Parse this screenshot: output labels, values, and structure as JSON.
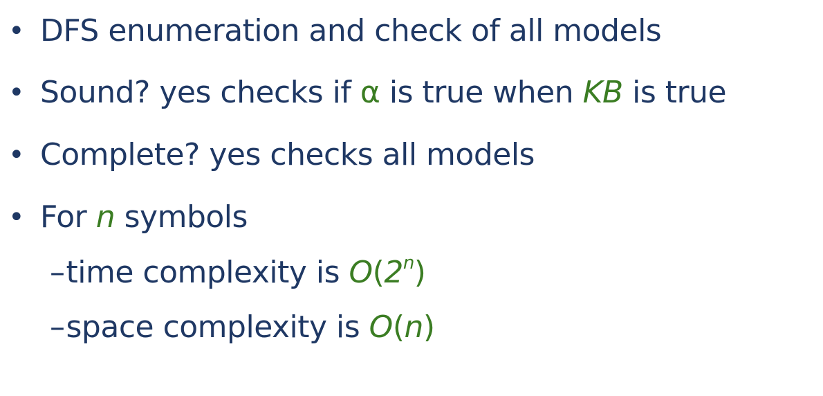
{
  "bullets": [
    {
      "text": "DFS enumeration and check of all models"
    },
    {
      "prefix": "Sound? yes checks if ",
      "alpha": "α",
      "middle": " is true when ",
      "kb": "KB",
      "suffix": " is true"
    },
    {
      "text": "Complete? yes checks all models"
    },
    {
      "prefix": "For ",
      "n": "n",
      "suffix": " symbols"
    }
  ],
  "sub_bullets": [
    {
      "dash": "–",
      "prefix": "time complexity is ",
      "big_o": "O",
      "open": "(",
      "base": "2",
      "exponent": "n",
      "close": ")"
    },
    {
      "dash": "–",
      "prefix": "space complexity is ",
      "big_o": "O",
      "open": "(",
      "arg": "n",
      "close": ")"
    }
  ],
  "bullet_symbol": "•",
  "colors": {
    "text": "#1f3864",
    "accent": "#3b7d23"
  }
}
